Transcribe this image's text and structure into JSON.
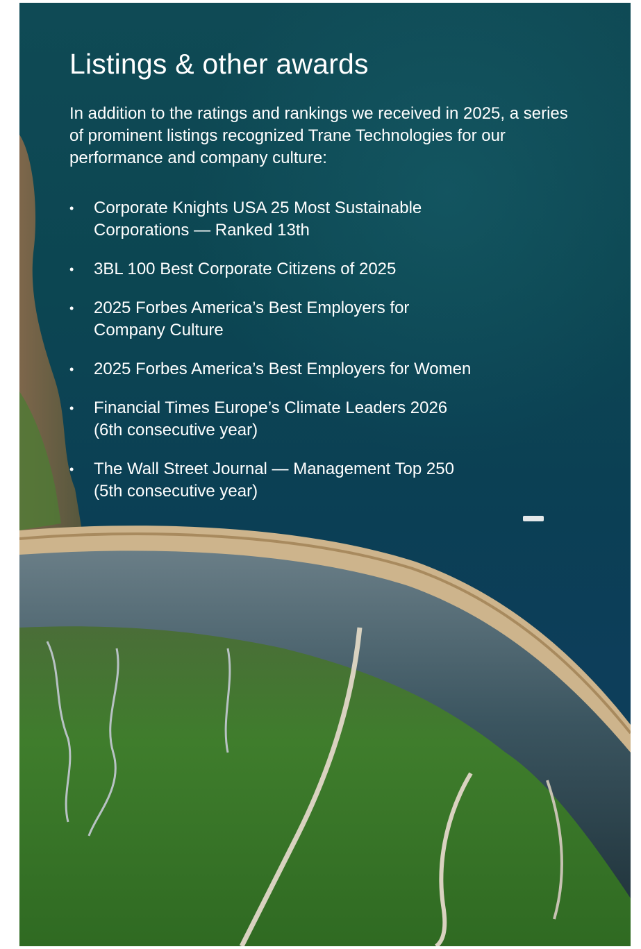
{
  "page": {
    "title": "Listings & other awards",
    "intro": "In addition to the ratings and rankings we received in 2025, a series of prominent listings recognized Trane Technologies for our performance and company culture:",
    "bullet": "•",
    "awards": [
      "Corporate Knights USA 25 Most Sustainable\nCorporations — Ranked 13th",
      "3BL 100 Best Corporate Citizens of 2025",
      "2025 Forbes America’s Best Employers for\nCompany Culture",
      "2025 Forbes America’s Best Employers for Women",
      "Financial Times Europe’s Climate Leaders 2026\n(6th consecutive year)",
      "The Wall Street Journal — Management Top 250\n(5th consecutive year)"
    ]
  },
  "colors": {
    "water": "#0d4552",
    "dam_top": "#c8b48a",
    "dam_face": "#2e4650",
    "forest": "#3f7a2a",
    "text": "#ffffff"
  }
}
